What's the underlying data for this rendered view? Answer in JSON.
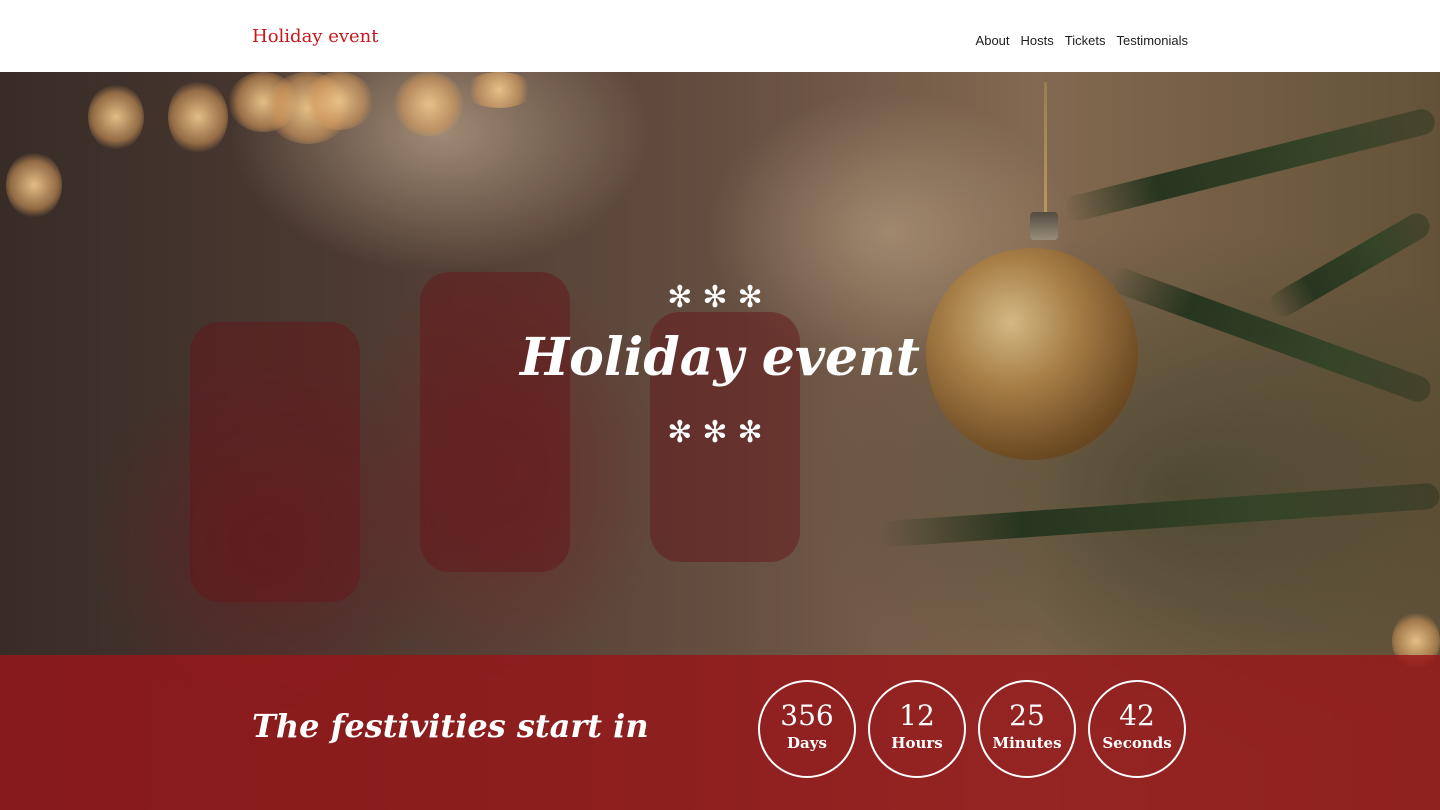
{
  "header": {
    "brand": "Holiday event",
    "nav": [
      "About",
      "Hosts",
      "Tickets",
      "Testimonials"
    ]
  },
  "hero": {
    "title": "Holiday event",
    "decoration_top": "✻✻✻",
    "decoration_bottom": "✻✻✻"
  },
  "countdown": {
    "headline": "The festivities start in",
    "units": [
      {
        "value": "356",
        "label": "Days"
      },
      {
        "value": "12",
        "label": "Hours"
      },
      {
        "value": "25",
        "label": "Minutes"
      },
      {
        "value": "42",
        "label": "Seconds"
      }
    ]
  },
  "colors": {
    "brand": "#c8161d",
    "band": "#981618",
    "text_light": "#ffffff"
  }
}
